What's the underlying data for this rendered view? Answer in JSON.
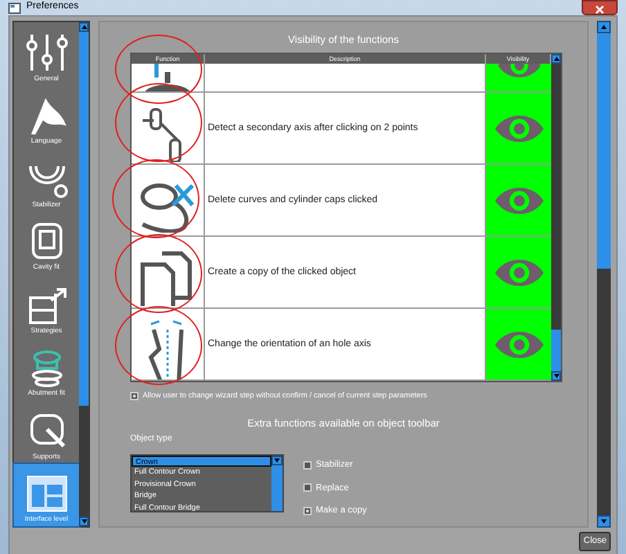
{
  "window": {
    "title": "Preferences"
  },
  "sidebar": {
    "items": [
      {
        "label": "General",
        "selected": false
      },
      {
        "label": "Language",
        "selected": false
      },
      {
        "label": "Stabilizer",
        "selected": false
      },
      {
        "label": "Cavity fit",
        "selected": false
      },
      {
        "label": "Strategies",
        "selected": false
      },
      {
        "label": "Abutment fit",
        "selected": false
      },
      {
        "label": "Supports",
        "selected": false
      },
      {
        "label": "Interface level",
        "selected": true
      }
    ]
  },
  "functions": {
    "title": "Visibility of the functions",
    "columns": [
      "Function",
      "Description",
      "Visibility"
    ],
    "rows": [
      {
        "visible": true
      },
      {
        "description": "Detect a secondary axis after clicking on 2 points",
        "visible": true
      },
      {
        "description": "Delete curves and cylinder caps clicked",
        "visible": true
      },
      {
        "description": "Create a copy of the clicked object",
        "visible": true
      },
      {
        "description": "Change the orientation of an hole axis",
        "visible": true
      }
    ]
  },
  "wizard_option": {
    "label": "Allow user to change wizard step without confirm / cancel of current step parameters",
    "checked": true
  },
  "extra": {
    "title": "Extra functions available on object toolbar",
    "object_type_label": "Object type",
    "object_types": [
      {
        "label": "Crown",
        "selected": true
      },
      {
        "label": "Full Contour Crown",
        "selected": false
      },
      {
        "label": "Provisional Crown",
        "selected": false
      },
      {
        "label": "Bridge",
        "selected": false
      },
      {
        "label": "Full Contour Bridge",
        "selected": false
      }
    ],
    "options": [
      {
        "label": "Stabilizer",
        "checked": false
      },
      {
        "label": "Replace",
        "checked": false
      },
      {
        "label": "Make a copy",
        "checked": true
      }
    ]
  },
  "buttons": {
    "close": "Close"
  }
}
